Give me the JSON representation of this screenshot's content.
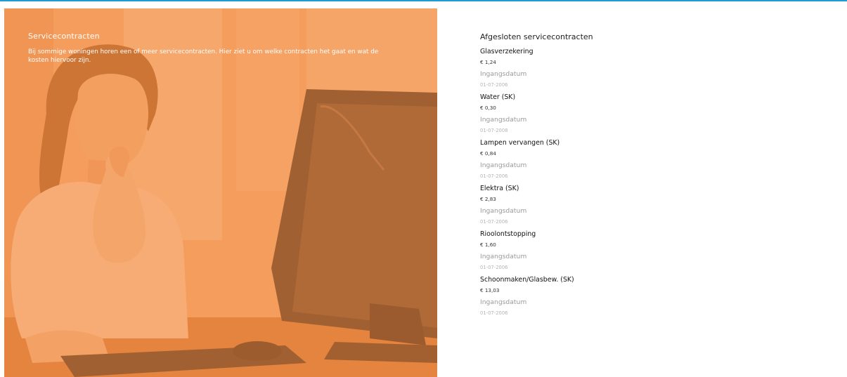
{
  "hero": {
    "title": "Servicecontracten",
    "description": "Bij sommige woningen horen een of meer servicecontracten. Hier ziet u om welke contracten het gaat en wat de kosten hiervoor zijn.",
    "image": "woman-at-computer-photo",
    "overlay_color": "#f68c3e"
  },
  "contracts": {
    "title": "Afgesloten servicecontracten",
    "items": [
      {
        "name": "Glasverzekering",
        "price": "€ 1,24",
        "date_label": "Ingangsdatum",
        "date": "01-07-2006"
      },
      {
        "name": "Water (SK)",
        "price": "€ 0,30",
        "date_label": "Ingangsdatum",
        "date": "01-07-2008"
      },
      {
        "name": "Lampen vervangen (SK)",
        "price": "€ 0,84",
        "date_label": "Ingangsdatum",
        "date": "01-07-2006"
      },
      {
        "name": "Elektra (SK)",
        "price": "€ 2,83",
        "date_label": "Ingangsdatum",
        "date": "01-07-2006"
      },
      {
        "name": "Rioolontstopping",
        "price": "€ 1,60",
        "date_label": "Ingangsdatum",
        "date": "01-07-2006"
      },
      {
        "name": "Schoonmaken/Glasbew. (SK)",
        "price": "€ 13,03",
        "date_label": "Ingangsdatum",
        "date": "01-07-2006"
      }
    ]
  },
  "colors": {
    "accent_border": "#1e9bd7"
  }
}
